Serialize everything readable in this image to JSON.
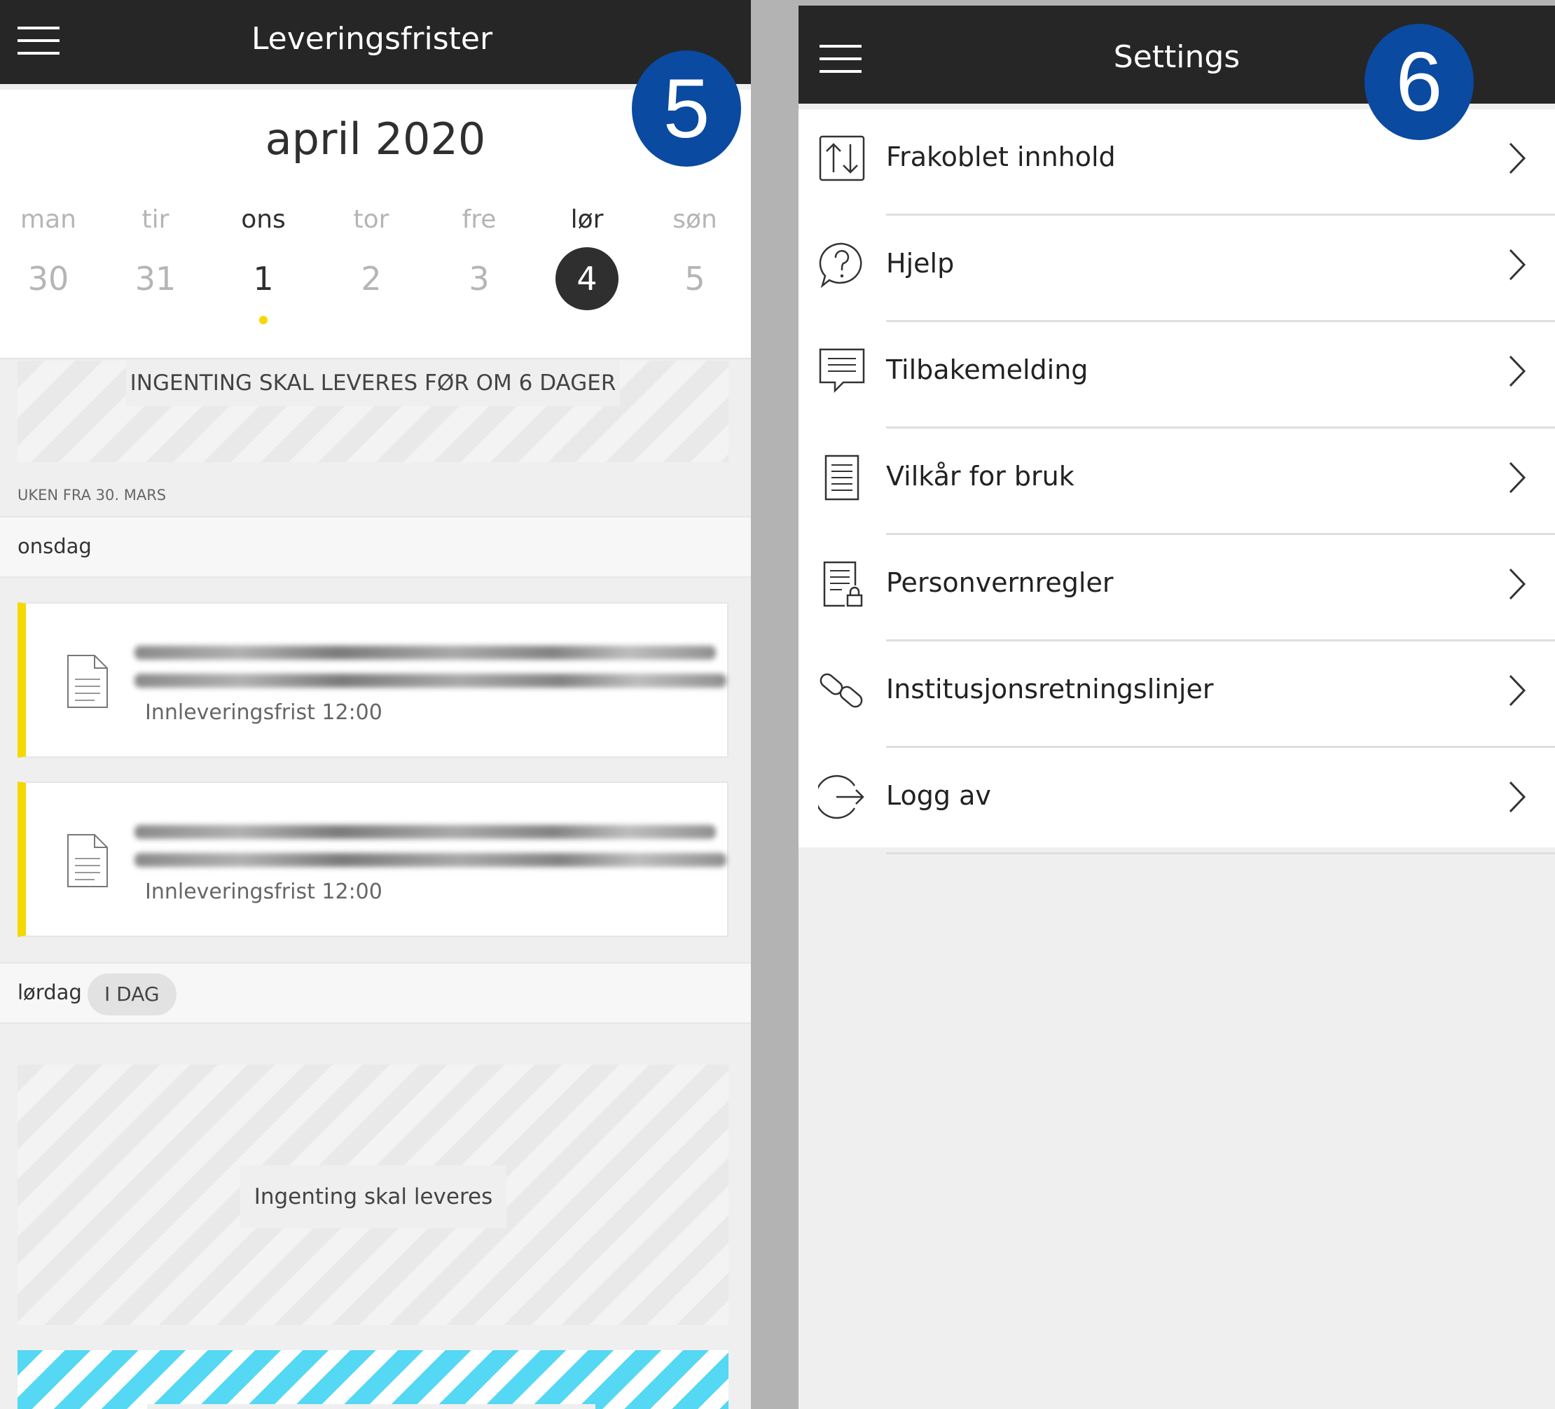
{
  "left_panel": {
    "title": "Leveringsfrister",
    "menu_icon": "hamburger-menu-icon",
    "month": "april 2020",
    "days": [
      {
        "name": "man",
        "date": "30"
      },
      {
        "name": "tir",
        "date": "31"
      },
      {
        "name": "ons",
        "date": "1"
      },
      {
        "name": "tor",
        "date": "2"
      },
      {
        "name": "fre",
        "date": "3"
      },
      {
        "name": "lør",
        "date": "4"
      },
      {
        "name": "søn",
        "date": "5"
      }
    ],
    "banner_top": "INGENTING SKAL LEVERES FØR OM 6 DAGER",
    "week_label": "UKEN FRA 30. MARS",
    "day_sections": [
      {
        "name": "onsdag"
      },
      {
        "name": "lørdag",
        "badge": "I DAG"
      }
    ],
    "items": [
      {
        "deadline": "Innleveringsfrist 12:00"
      },
      {
        "deadline": "Innleveringsfrist 12:00"
      }
    ],
    "banner_bottom": "Ingenting skal leveres",
    "step_badge": "5"
  },
  "right_panel": {
    "title": "Settings",
    "menu_icon": "hamburger-menu-icon",
    "step_badge": "6",
    "menu_items": [
      {
        "label": "Frakoblet innhold",
        "icon": "offline-sync-icon"
      },
      {
        "label": "Hjelp",
        "icon": "help-icon"
      },
      {
        "label": "Tilbakemelding",
        "icon": "feedback-icon"
      },
      {
        "label": "Vilkår for bruk",
        "icon": "terms-document-icon"
      },
      {
        "label": "Personvernregler",
        "icon": "privacy-document-icon"
      },
      {
        "label": "Institusjonsretningslinjer",
        "icon": "link-icon"
      },
      {
        "label": "Logg av",
        "icon": "logout-icon"
      }
    ]
  },
  "colors": {
    "topbar": "#262626",
    "accent_yellow": "#f4d800",
    "badge_blue": "#0a4aa0",
    "stripe_blue": "#54d8f4"
  }
}
